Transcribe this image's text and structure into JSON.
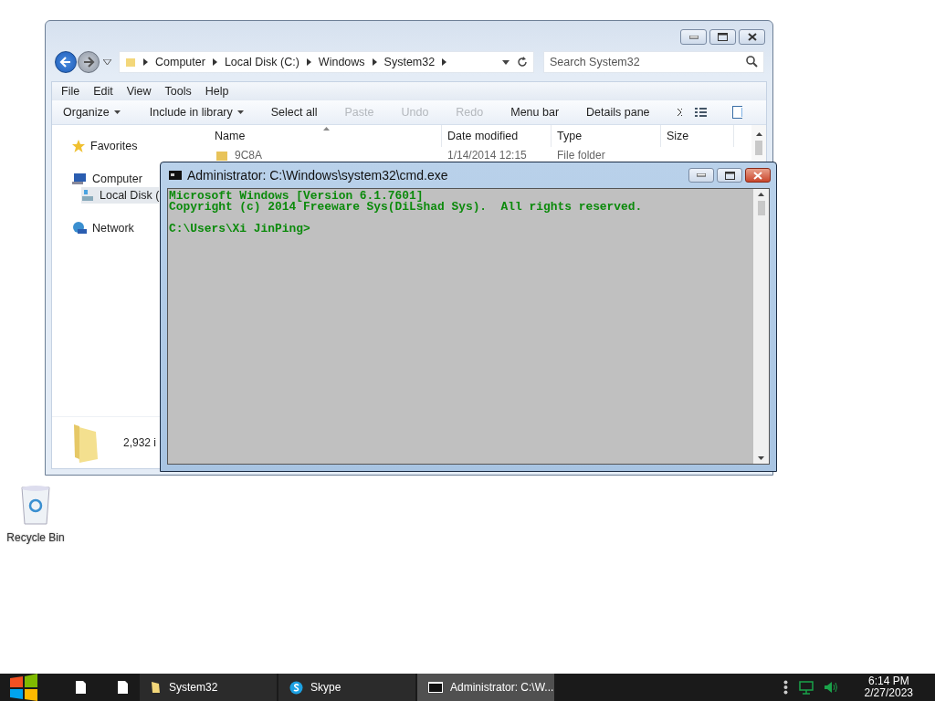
{
  "explorer": {
    "breadcrumb": [
      "Computer",
      "Local Disk (C:)",
      "Windows",
      "System32"
    ],
    "search": {
      "placeholder": "Search System32"
    },
    "menu": [
      "File",
      "Edit",
      "View",
      "Tools",
      "Help"
    ],
    "toolbar": [
      {
        "label": "Organize",
        "dropdown": true,
        "disabled": false
      },
      {
        "label": "Include in library",
        "dropdown": true,
        "disabled": false
      },
      {
        "label": "Select all",
        "dropdown": false,
        "disabled": false
      },
      {
        "label": "Paste",
        "dropdown": false,
        "disabled": true
      },
      {
        "label": "Undo",
        "dropdown": false,
        "disabled": true
      },
      {
        "label": "Redo",
        "dropdown": false,
        "disabled": true
      },
      {
        "label": "Menu bar",
        "dropdown": false,
        "disabled": false
      },
      {
        "label": "Details pane",
        "dropdown": false,
        "disabled": false
      }
    ],
    "nav": [
      {
        "label": "Favorites",
        "kind": "favorites",
        "selected": false
      },
      {
        "label": "Computer",
        "kind": "computer",
        "selected": false
      },
      {
        "label": "Local Disk (",
        "kind": "disk",
        "selected": true
      },
      {
        "label": "Network",
        "kind": "network",
        "selected": false
      }
    ],
    "columns": [
      "Name",
      "Date modified",
      "Type",
      "Size"
    ],
    "rows": [
      {
        "name": "9C8A",
        "date": "1/14/2014 12:15",
        "type": "File folder"
      }
    ],
    "status": "2,932 i"
  },
  "console": {
    "title": "Administrator: C:\\Windows\\system32\\cmd.exe",
    "lines": [
      "Microsoft Windows [Version 6.1.7601]",
      "Copyright (c) 2014 Freeware Sys(DiLshad Sys).  All rights reserved."
    ],
    "prompt": "C:\\Users\\Xi JinPing>"
  },
  "desktop_icons": [
    {
      "label": "Recycle Bin"
    }
  ],
  "taskbar": {
    "items": [
      {
        "kind": "document",
        "selected": false
      },
      {
        "kind": "document",
        "selected": false
      },
      {
        "kind": "folder",
        "label": "System32",
        "selected": false
      },
      {
        "kind": "skype",
        "label": "Skype",
        "selected": false
      },
      {
        "kind": "console",
        "label": "Administrator: C:\\W...",
        "selected": true
      }
    ],
    "time": "6:14 PM",
    "date": "2/27/2023"
  }
}
